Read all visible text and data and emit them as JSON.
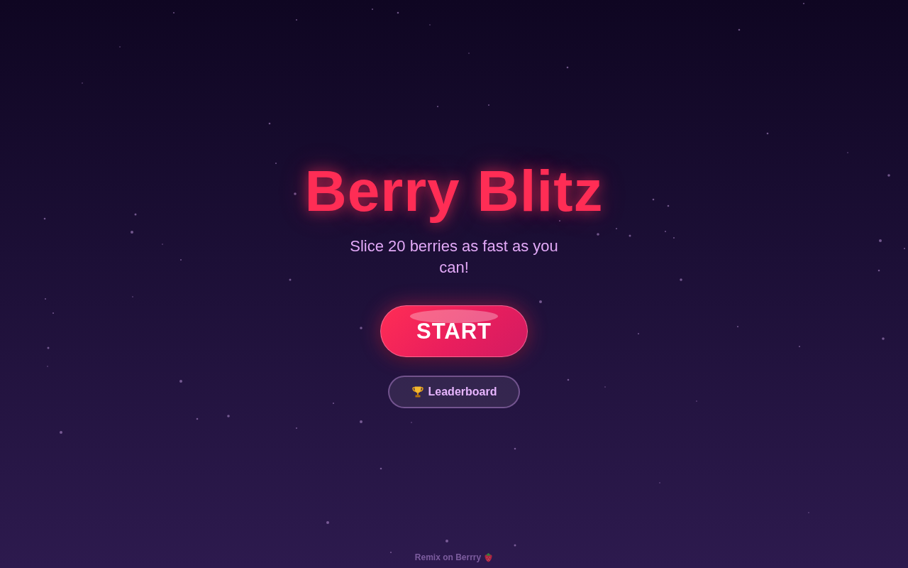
{
  "title": "Berry Blitz",
  "subtitle": "Slice 20 berries as fast as you can!",
  "buttons": [
    {
      "kind": "primary",
      "label": "START"
    },
    {
      "kind": "secondary",
      "label": "Leaderboard"
    }
  ],
  "footer": {
    "text": "Remix on Berrry"
  }
}
